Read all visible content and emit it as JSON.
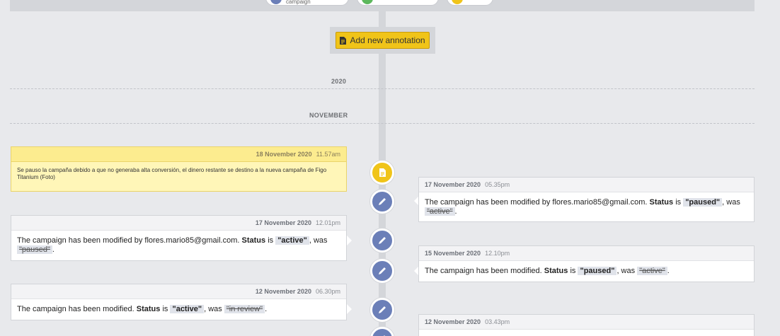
{
  "topbar": {
    "chips": [
      {
        "label": "campaign",
        "color": "#6b7fb8"
      },
      {
        "label": "",
        "color": "#5cb85c"
      },
      {
        "label": "",
        "color": "#f0c419"
      }
    ]
  },
  "add_button": {
    "label": "Add new annotation",
    "icon": "document-icon"
  },
  "dividers": {
    "year": "2020",
    "month": "NOVEMBER"
  },
  "entries": [
    {
      "type": "note",
      "date": "18 November 2020",
      "time": "11.57am",
      "text": "Se pauso la campaña debido a que no generaba alta conversión, el dinero restante se destino a la nueva campaña de Figo Titanium (Foto)"
    },
    {
      "type": "change",
      "date": "17 November 2020",
      "time": "05.35pm",
      "prefix": "The campaign has been modified by flores.mario85@gmail.com.",
      "field": "Status",
      "is": "is",
      "new": "\"paused\"",
      "was": ", was",
      "old": "\"active\"",
      "end": "."
    },
    {
      "type": "change",
      "date": "17 November 2020",
      "time": "12.01pm",
      "prefix": "The campaign has been modified by flores.mario85@gmail.com.",
      "field": "Status",
      "is": "is",
      "new": "\"active\"",
      "was": ", was",
      "old": "\"paused\"",
      "end": "."
    },
    {
      "type": "change",
      "date": "15 November 2020",
      "time": "12.10pm",
      "prefix": "The campaign has been modified.",
      "field": "Status",
      "is": "is",
      "new": "\"paused\"",
      "was": ", was",
      "old": "\"active\"",
      "end": "."
    },
    {
      "type": "change",
      "date": "12 November 2020",
      "time": "06.30pm",
      "prefix": "The campaign has been modified.",
      "field": "Status",
      "is": "is",
      "new": "\"active\"",
      "was": ", was",
      "old": "\"in review\"",
      "end": "."
    },
    {
      "type": "change",
      "date": "12 November 2020",
      "time": "03.43pm"
    }
  ]
}
